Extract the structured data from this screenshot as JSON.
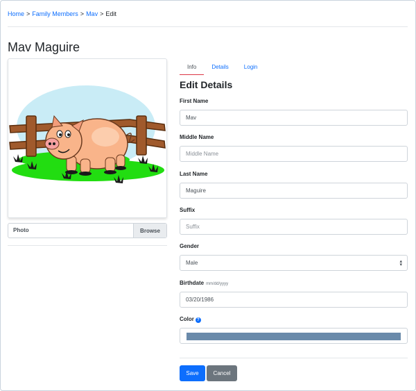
{
  "breadcrumb": {
    "home": "Home",
    "family_members": "Family Members",
    "member": "Mav",
    "current": "Edit",
    "separator": ">"
  },
  "page_title": "Mav Maguire",
  "photo": {
    "label": "Photo",
    "browse_label": "Browse",
    "image_alt": "cartoon pig in front of wooden fence on grass"
  },
  "tabs": [
    {
      "label": "Info",
      "active": true
    },
    {
      "label": "Details",
      "active": false
    },
    {
      "label": "Login",
      "active": false
    }
  ],
  "section_title": "Edit Details",
  "fields": {
    "first_name": {
      "label": "First Name",
      "value": "Mav",
      "placeholder": ""
    },
    "middle_name": {
      "label": "Middle Name",
      "value": "",
      "placeholder": "Middle Name"
    },
    "last_name": {
      "label": "Last Name",
      "value": "Maguire",
      "placeholder": ""
    },
    "suffix": {
      "label": "Suffix",
      "value": "",
      "placeholder": "Suffix"
    },
    "gender": {
      "label": "Gender",
      "value": "Male"
    },
    "birthdate": {
      "label": "Birthdate",
      "hint": "mm/dd/yyyy",
      "value": "03/20/1986"
    },
    "color": {
      "label": "Color",
      "help_icon": "question-circle-icon",
      "value": "#6a8aaa"
    }
  },
  "buttons": {
    "save": "Save",
    "cancel": "Cancel"
  },
  "colors": {
    "link": "#0d6efd",
    "active_tab_border": "#dc3545",
    "save_button": "#0d6efd",
    "cancel_button": "#6c757d"
  }
}
